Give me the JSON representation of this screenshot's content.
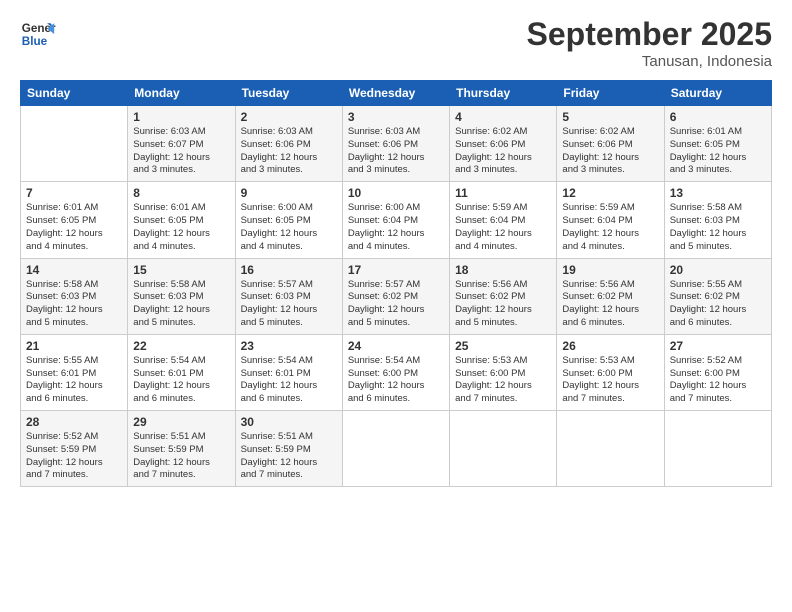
{
  "logo": {
    "line1": "General",
    "line2": "Blue"
  },
  "title": "September 2025",
  "subtitle": "Tanusan, Indonesia",
  "days_of_week": [
    "Sunday",
    "Monday",
    "Tuesday",
    "Wednesday",
    "Thursday",
    "Friday",
    "Saturday"
  ],
  "weeks": [
    [
      {
        "day": "",
        "info": ""
      },
      {
        "day": "1",
        "info": "Sunrise: 6:03 AM\nSunset: 6:07 PM\nDaylight: 12 hours\nand 3 minutes."
      },
      {
        "day": "2",
        "info": "Sunrise: 6:03 AM\nSunset: 6:06 PM\nDaylight: 12 hours\nand 3 minutes."
      },
      {
        "day": "3",
        "info": "Sunrise: 6:03 AM\nSunset: 6:06 PM\nDaylight: 12 hours\nand 3 minutes."
      },
      {
        "day": "4",
        "info": "Sunrise: 6:02 AM\nSunset: 6:06 PM\nDaylight: 12 hours\nand 3 minutes."
      },
      {
        "day": "5",
        "info": "Sunrise: 6:02 AM\nSunset: 6:06 PM\nDaylight: 12 hours\nand 3 minutes."
      },
      {
        "day": "6",
        "info": "Sunrise: 6:01 AM\nSunset: 6:05 PM\nDaylight: 12 hours\nand 3 minutes."
      }
    ],
    [
      {
        "day": "7",
        "info": "Sunrise: 6:01 AM\nSunset: 6:05 PM\nDaylight: 12 hours\nand 4 minutes."
      },
      {
        "day": "8",
        "info": "Sunrise: 6:01 AM\nSunset: 6:05 PM\nDaylight: 12 hours\nand 4 minutes."
      },
      {
        "day": "9",
        "info": "Sunrise: 6:00 AM\nSunset: 6:05 PM\nDaylight: 12 hours\nand 4 minutes."
      },
      {
        "day": "10",
        "info": "Sunrise: 6:00 AM\nSunset: 6:04 PM\nDaylight: 12 hours\nand 4 minutes."
      },
      {
        "day": "11",
        "info": "Sunrise: 5:59 AM\nSunset: 6:04 PM\nDaylight: 12 hours\nand 4 minutes."
      },
      {
        "day": "12",
        "info": "Sunrise: 5:59 AM\nSunset: 6:04 PM\nDaylight: 12 hours\nand 4 minutes."
      },
      {
        "day": "13",
        "info": "Sunrise: 5:58 AM\nSunset: 6:03 PM\nDaylight: 12 hours\nand 5 minutes."
      }
    ],
    [
      {
        "day": "14",
        "info": "Sunrise: 5:58 AM\nSunset: 6:03 PM\nDaylight: 12 hours\nand 5 minutes."
      },
      {
        "day": "15",
        "info": "Sunrise: 5:58 AM\nSunset: 6:03 PM\nDaylight: 12 hours\nand 5 minutes."
      },
      {
        "day": "16",
        "info": "Sunrise: 5:57 AM\nSunset: 6:03 PM\nDaylight: 12 hours\nand 5 minutes."
      },
      {
        "day": "17",
        "info": "Sunrise: 5:57 AM\nSunset: 6:02 PM\nDaylight: 12 hours\nand 5 minutes."
      },
      {
        "day": "18",
        "info": "Sunrise: 5:56 AM\nSunset: 6:02 PM\nDaylight: 12 hours\nand 5 minutes."
      },
      {
        "day": "19",
        "info": "Sunrise: 5:56 AM\nSunset: 6:02 PM\nDaylight: 12 hours\nand 6 minutes."
      },
      {
        "day": "20",
        "info": "Sunrise: 5:55 AM\nSunset: 6:02 PM\nDaylight: 12 hours\nand 6 minutes."
      }
    ],
    [
      {
        "day": "21",
        "info": "Sunrise: 5:55 AM\nSunset: 6:01 PM\nDaylight: 12 hours\nand 6 minutes."
      },
      {
        "day": "22",
        "info": "Sunrise: 5:54 AM\nSunset: 6:01 PM\nDaylight: 12 hours\nand 6 minutes."
      },
      {
        "day": "23",
        "info": "Sunrise: 5:54 AM\nSunset: 6:01 PM\nDaylight: 12 hours\nand 6 minutes."
      },
      {
        "day": "24",
        "info": "Sunrise: 5:54 AM\nSunset: 6:00 PM\nDaylight: 12 hours\nand 6 minutes."
      },
      {
        "day": "25",
        "info": "Sunrise: 5:53 AM\nSunset: 6:00 PM\nDaylight: 12 hours\nand 7 minutes."
      },
      {
        "day": "26",
        "info": "Sunrise: 5:53 AM\nSunset: 6:00 PM\nDaylight: 12 hours\nand 7 minutes."
      },
      {
        "day": "27",
        "info": "Sunrise: 5:52 AM\nSunset: 6:00 PM\nDaylight: 12 hours\nand 7 minutes."
      }
    ],
    [
      {
        "day": "28",
        "info": "Sunrise: 5:52 AM\nSunset: 5:59 PM\nDaylight: 12 hours\nand 7 minutes."
      },
      {
        "day": "29",
        "info": "Sunrise: 5:51 AM\nSunset: 5:59 PM\nDaylight: 12 hours\nand 7 minutes."
      },
      {
        "day": "30",
        "info": "Sunrise: 5:51 AM\nSunset: 5:59 PM\nDaylight: 12 hours\nand 7 minutes."
      },
      {
        "day": "",
        "info": ""
      },
      {
        "day": "",
        "info": ""
      },
      {
        "day": "",
        "info": ""
      },
      {
        "day": "",
        "info": ""
      }
    ]
  ]
}
